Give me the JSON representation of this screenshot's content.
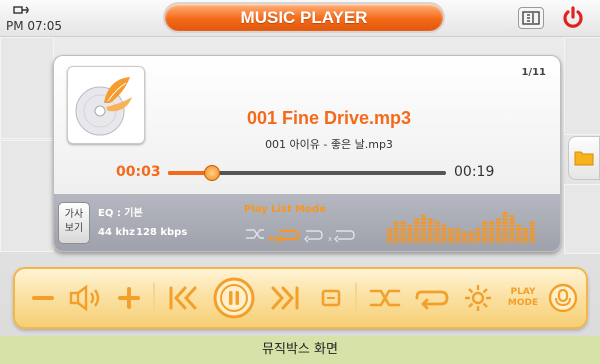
{
  "status": {
    "time": "PM 07:05"
  },
  "header": {
    "title": "MUSIC PLAYER"
  },
  "now_playing": {
    "track_counter": "1/11",
    "title": "001 Fine Drive.mp3",
    "artist_line": "001 아이유 - 좋은 날.mp3",
    "elapsed": "00:03",
    "duration": "00:19",
    "progress_fraction": 0.16
  },
  "info": {
    "lyrics_line1": "가사",
    "lyrics_line2": "보기",
    "eq": "EQ : 기본",
    "sample_rate": "44 khz",
    "bitrate": "128 kbps",
    "playlist_mode_label": "Play List Mode",
    "mode_all_label": "All",
    "mode_x_label": "x"
  },
  "controls": {
    "play_mode_line1": "PLAY",
    "play_mode_line2": "MODE"
  },
  "spectrum_levels": [
    0.45,
    0.55,
    0.6,
    0.5,
    0.65,
    0.75,
    0.7,
    0.55,
    0.5,
    0.45,
    0.4,
    0.35,
    0.3,
    0.4,
    0.55,
    0.6,
    0.7,
    0.8,
    0.75,
    0.5,
    0.45,
    0.55
  ],
  "colors": {
    "accent": "#f46a1a",
    "control_bar": "#f6cf75",
    "spectrum": "#f8961f"
  },
  "caption": "뮤직박스 화면"
}
